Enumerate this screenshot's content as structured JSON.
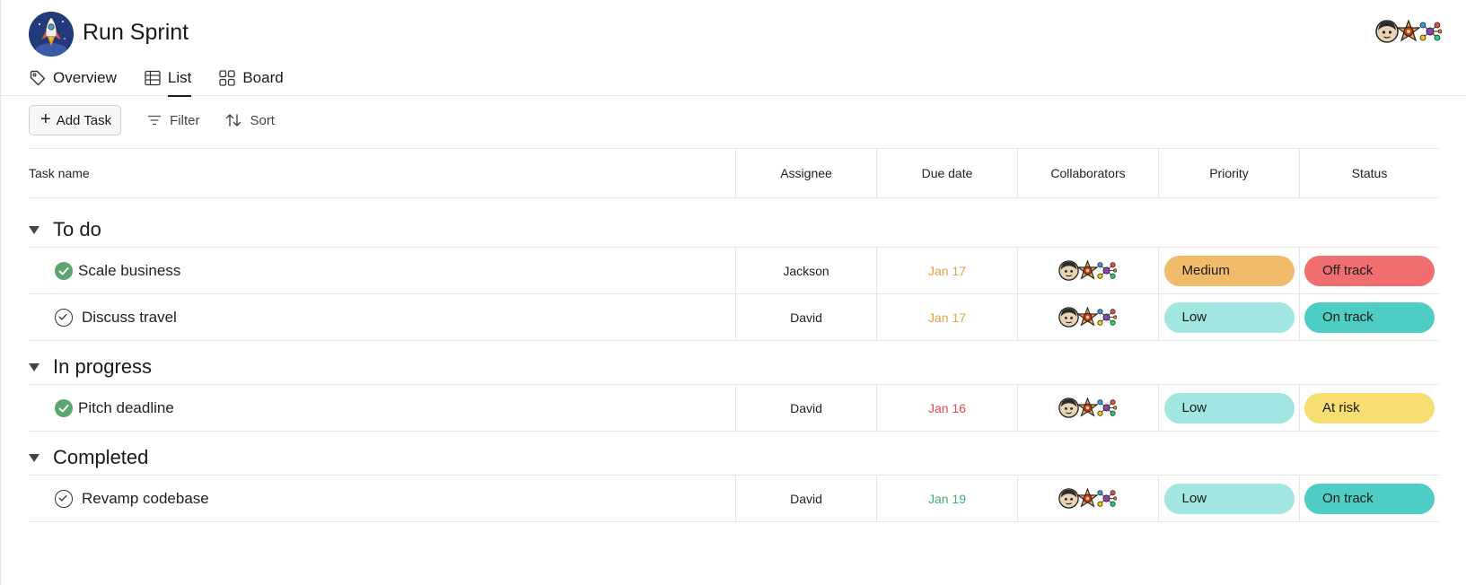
{
  "app": {
    "title": "Run Sprint",
    "logo_icon": "rocket-icon"
  },
  "tabs": [
    {
      "label": "Overview",
      "icon": "tag-icon",
      "active": false
    },
    {
      "label": "List",
      "icon": "table-icon",
      "active": true
    },
    {
      "label": "Board",
      "icon": "grid-icon",
      "active": false
    }
  ],
  "toolbar": {
    "add_task": "Add Task",
    "filter": "Filter",
    "sort": "Sort"
  },
  "columns": {
    "task_name": "Task name",
    "assignee": "Assignee",
    "due_date": "Due date",
    "collaborators": "Collaborators",
    "priority": "Priority",
    "status": "Status"
  },
  "colors": {
    "priority_medium": "#f0bb6a",
    "priority_low": "#a1e6e1",
    "status_off_track": "#f06d70",
    "status_on_track": "#4ecdc4",
    "status_at_risk": "#f6de73",
    "due_orange": "#e6a23c",
    "due_red": "#e5484d",
    "due_green": "#3cb371",
    "check_done": "#5aa66e"
  },
  "sections": [
    {
      "title": "To do",
      "rows": [
        {
          "name": "Scale business",
          "done": true,
          "assignee": "Jackson",
          "due": "Jan 17",
          "due_color": "#e6a23c",
          "priority": "Medium",
          "priority_color": "#f0bb6a",
          "status": "Off track",
          "status_color": "#f06d70"
        },
        {
          "name": "Discuss travel",
          "done": false,
          "assignee": "David",
          "due": "Jan 17",
          "due_color": "#e6a23c",
          "priority": "Low",
          "priority_color": "#a1e6e1",
          "status": "On track",
          "status_color": "#4ecdc4"
        }
      ]
    },
    {
      "title": "In progress",
      "rows": [
        {
          "name": "Pitch deadline",
          "done": true,
          "assignee": "David",
          "due": "Jan 16",
          "due_color": "#e5484d",
          "priority": "Low",
          "priority_color": "#a1e6e1",
          "status": "At risk",
          "status_color": "#f6de73"
        }
      ]
    },
    {
      "title": "Completed",
      "rows": [
        {
          "name": "Revamp codebase",
          "done": false,
          "assignee": "David",
          "due": "Jan 19",
          "due_color": "#3cb371",
          "priority": "Low",
          "priority_color": "#a1e6e1",
          "status": "On track",
          "status_color": "#4ecdc4"
        }
      ]
    }
  ]
}
